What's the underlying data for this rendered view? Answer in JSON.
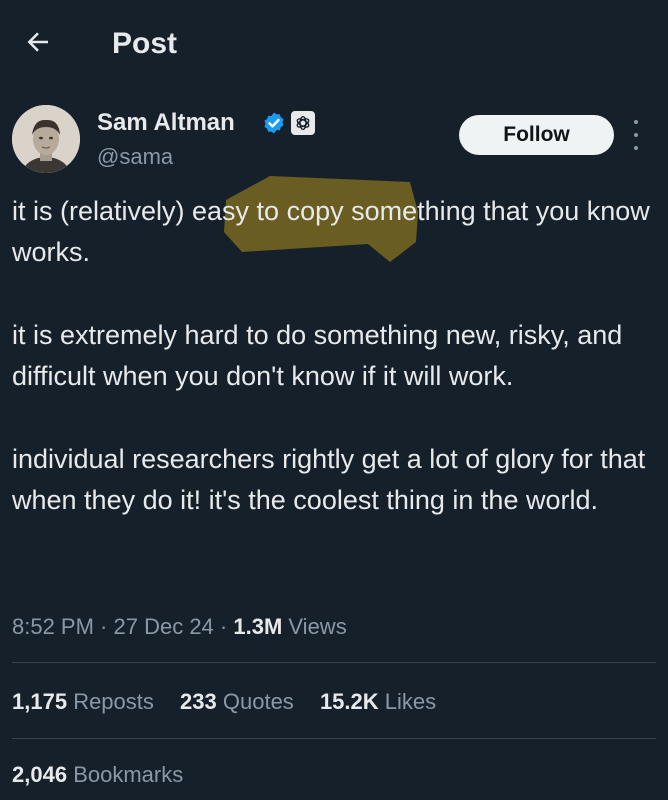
{
  "header": {
    "title": "Post",
    "back_icon": "arrow-left-icon"
  },
  "author": {
    "name": "Sam Altman",
    "handle": "@sama",
    "verified_color": "#1d9bf0",
    "affiliation_icon": "openai-logo-icon"
  },
  "follow_button": {
    "label": "Follow"
  },
  "tweet": {
    "paragraphs": [
      "it is (relatively) easy to copy something that you know works.",
      "it is extremely hard to do something new, risky, and difficult when you don't know if it will work.",
      "individual researchers rightly get a lot of glory for that when they do it! it's the coolest thing in the world."
    ],
    "highlight_color": "#7a6a1f"
  },
  "meta": {
    "time": "8:52 PM",
    "date": "27 Dec 24",
    "views_count": "1.3M",
    "views_label": "Views",
    "separator": " · "
  },
  "stats": [
    {
      "count": "1,175",
      "label": "Reposts"
    },
    {
      "count": "233",
      "label": "Quotes"
    },
    {
      "count": "15.2K",
      "label": "Likes"
    }
  ],
  "bookmarks": {
    "count": "2,046",
    "label": "Bookmarks"
  },
  "colors": {
    "background": "#15202b",
    "text": "#e7e9ea",
    "secondary_text": "#8b98a5",
    "divider": "#38444d"
  }
}
